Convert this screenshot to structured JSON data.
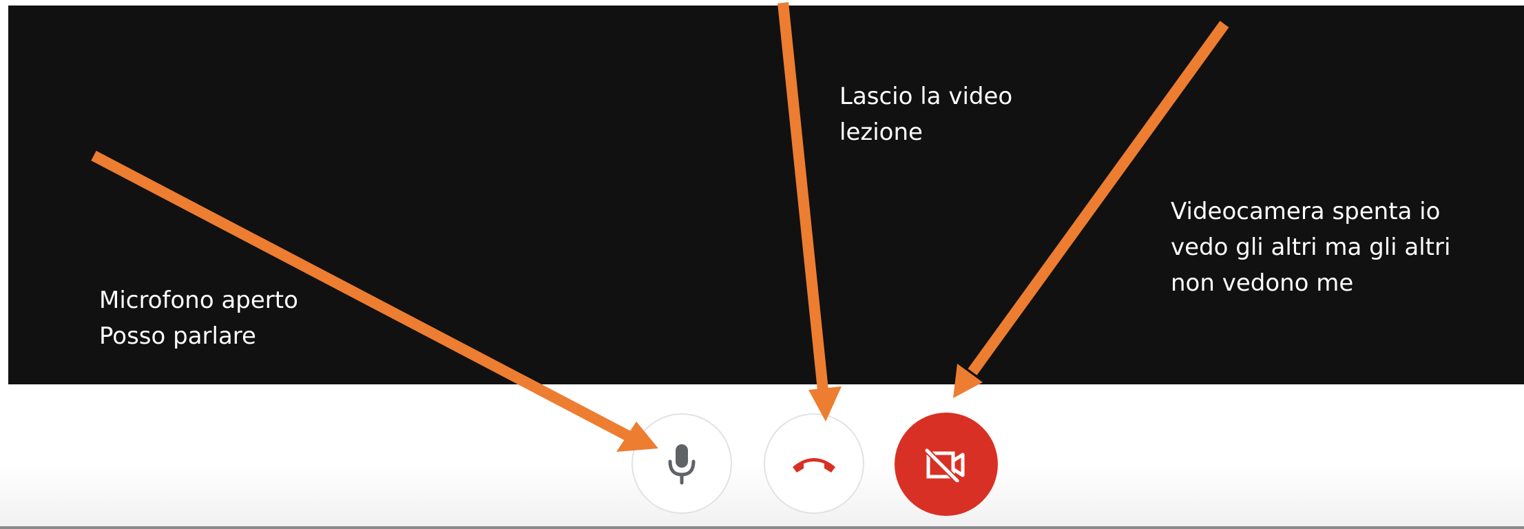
{
  "annotations": {
    "microphone": "Microfono aperto\nPosso parlare",
    "leave": "Lascio  la video\nlezione",
    "camera": "Videocamera spenta io\nvedo  gli altri ma gli altri\nnon vedono me"
  },
  "controls": [
    {
      "name": "microphone",
      "icon": "microphone-icon",
      "state": "on"
    },
    {
      "name": "hang-up",
      "icon": "phone-hangup-icon",
      "state": "idle"
    },
    {
      "name": "camera",
      "icon": "video-off-icon",
      "state": "off"
    }
  ],
  "colors": {
    "background_dark": "#111111",
    "arrow": "#ed7d31",
    "hangup_red": "#d93025",
    "camera_off_bg": "#d93025",
    "mic_icon": "#5f6368",
    "annotation_text": "#ffffff"
  }
}
